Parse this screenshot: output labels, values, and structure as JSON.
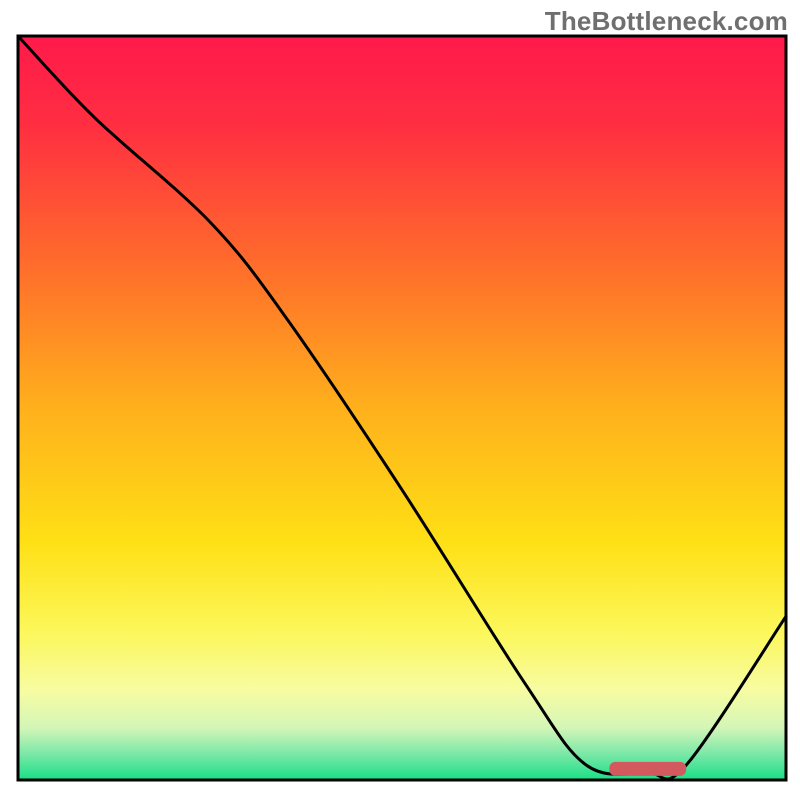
{
  "watermark": "TheBottleneck.com",
  "chart_data": {
    "type": "line",
    "title": "",
    "xlabel": "",
    "ylabel": "",
    "xlim": [
      0,
      100
    ],
    "ylim": [
      0,
      100
    ],
    "gradient_stops": [
      {
        "offset": 0.0,
        "color": "#ff1a4b"
      },
      {
        "offset": 0.12,
        "color": "#ff2e41"
      },
      {
        "offset": 0.3,
        "color": "#ff6a2c"
      },
      {
        "offset": 0.5,
        "color": "#ffb01c"
      },
      {
        "offset": 0.68,
        "color": "#fee015"
      },
      {
        "offset": 0.8,
        "color": "#fcf75a"
      },
      {
        "offset": 0.88,
        "color": "#f7fca2"
      },
      {
        "offset": 0.93,
        "color": "#d3f6b8"
      },
      {
        "offset": 0.965,
        "color": "#7be8a8"
      },
      {
        "offset": 1.0,
        "color": "#18df86"
      }
    ],
    "curve": {
      "x": [
        0,
        10,
        25,
        35,
        50,
        66,
        74,
        82,
        87,
        100
      ],
      "y": [
        100,
        89,
        75,
        62,
        39,
        13,
        2,
        1,
        2,
        22
      ]
    },
    "marker": {
      "x_start": 77,
      "x_end": 87,
      "y": 1.5,
      "color": "#d25a5f"
    }
  }
}
